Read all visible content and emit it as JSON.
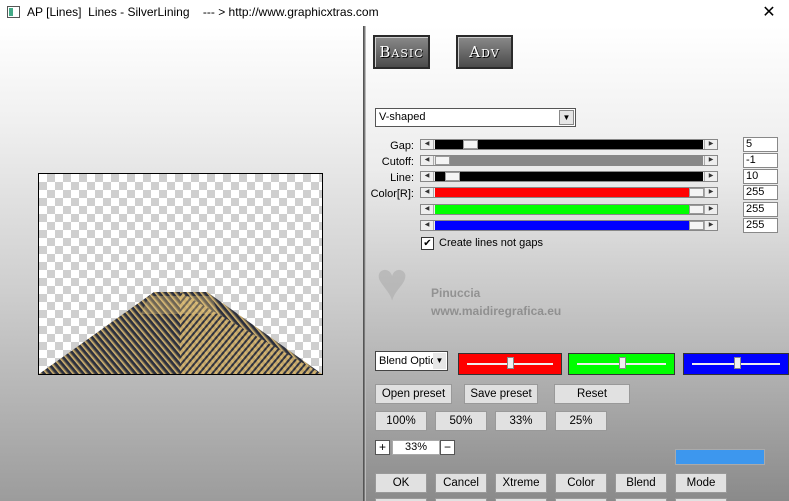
{
  "window": {
    "title": "AP [Lines]  Lines - SilverLining    --- > http://www.graphicxtras.com",
    "close_glyph": "✕"
  },
  "mode_buttons": {
    "basic_label": "Basic",
    "adv_label": "Adv"
  },
  "effect_dropdown": {
    "selected": "V-shaped"
  },
  "params": {
    "gap_label": "Gap:",
    "gap_value": "5",
    "cutoff_label": "Cutoff:",
    "cutoff_value": "-1",
    "line_label": "Line:",
    "line_value": "10",
    "color_r_label": "Color[R]:",
    "color_r_value": "255",
    "color_g_value": "255",
    "color_b_value": "255"
  },
  "checkbox": {
    "checked_glyph": "✔",
    "label": "Create lines not gaps"
  },
  "watermark": {
    "name": "Pinuccia",
    "url": "www.maidiregrafica.eu"
  },
  "blend": {
    "selected": "Blend Options"
  },
  "preset_buttons": {
    "open": "Open preset",
    "save": "Save preset",
    "reset": "Reset"
  },
  "zoom_buttons": [
    "100%",
    "50%",
    "33%",
    "25%"
  ],
  "zoom": {
    "plus": "+",
    "value": "33%",
    "minus": "−"
  },
  "bottom_buttons": [
    "OK",
    "Cancel",
    "Xtreme",
    "Color",
    "Blend",
    "Mode"
  ],
  "colors": {
    "red": "#ff0000",
    "green": "#00ff00",
    "blue": "#0000ff",
    "swatch": "#3d97ee"
  },
  "sliders": {
    "gap_position": 0.13,
    "cutoff_position": 0.0,
    "line_position": 0.04,
    "color_r_position": 1.0,
    "color_g_position": 1.0,
    "color_b_position": 1.0
  }
}
